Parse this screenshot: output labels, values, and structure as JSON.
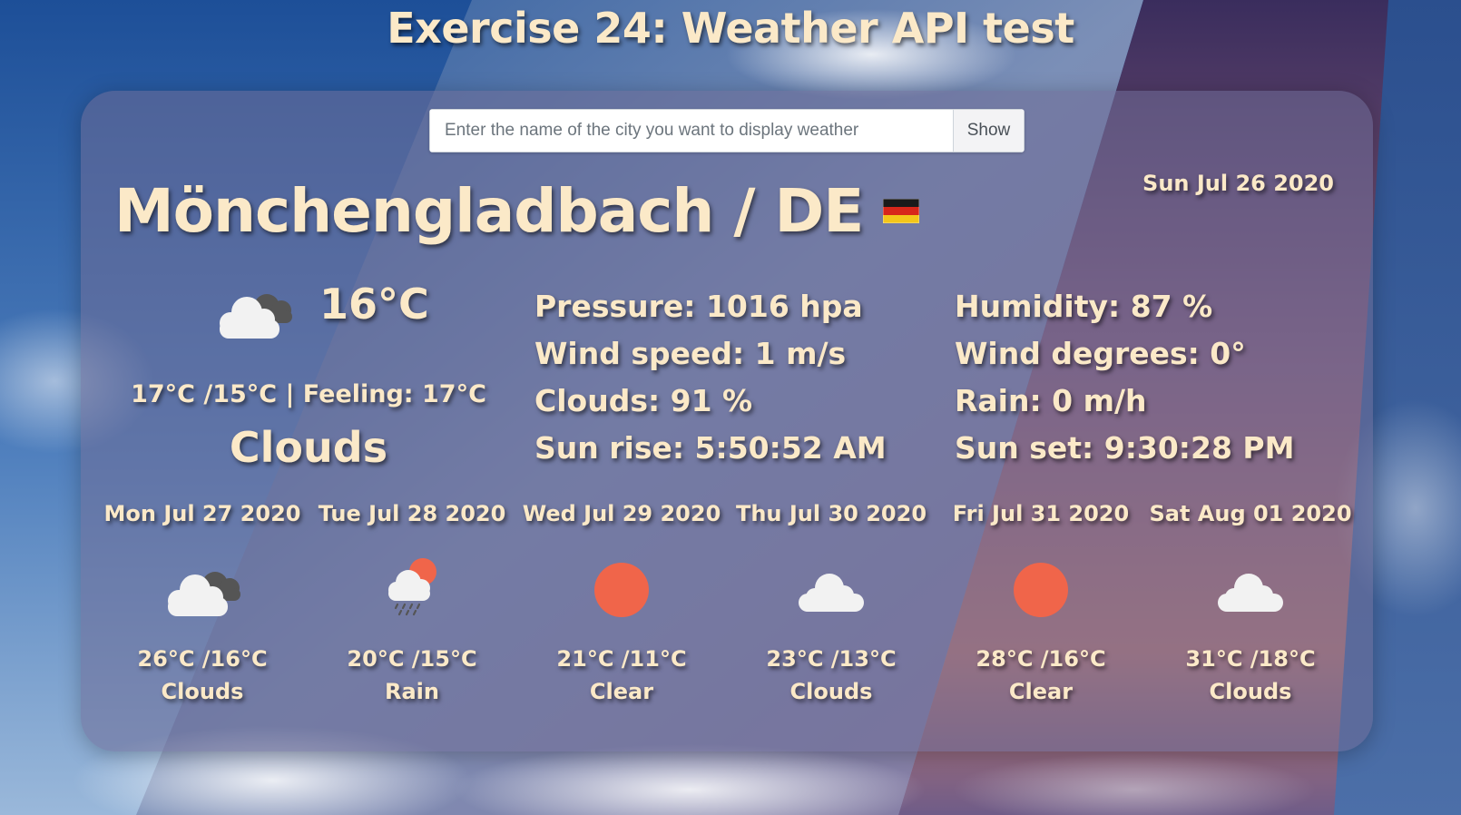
{
  "page": {
    "title": "Exercise 24: Weather API test"
  },
  "search": {
    "placeholder": "Enter the name of the city you want to display weather",
    "value": "",
    "button_label": "Show"
  },
  "current": {
    "city_label": "Mönchengladbach / DE",
    "flag_icon": "germany-flag-icon",
    "date": "Sun Jul 26 2020",
    "icon": "cloudy-icon",
    "temperature": "16°C",
    "min_max_feeling": "17°C /15°C | Feeling: 17°C",
    "condition": "Clouds",
    "details_left": [
      "Pressure: 1016 hpa",
      "Wind speed: 1 m/s",
      "Clouds: 91 %",
      "Sun rise: 5:50:52 AM"
    ],
    "details_right": [
      "Humidity: 87 %",
      "Wind degrees: 0°",
      "Rain: 0 m/h",
      "Sun set: 9:30:28 PM"
    ]
  },
  "forecast": [
    {
      "date": "Mon Jul 27 2020",
      "icon": "cloudy-icon",
      "temps": "26°C /16°C",
      "condition": "Clouds"
    },
    {
      "date": "Tue Jul 28 2020",
      "icon": "rain-sun-icon",
      "temps": "20°C /15°C",
      "condition": "Rain"
    },
    {
      "date": "Wed Jul 29 2020",
      "icon": "sun-icon",
      "temps": "21°C /11°C",
      "condition": "Clear"
    },
    {
      "date": "Thu Jul 30 2020",
      "icon": "cloud-icon",
      "temps": "23°C /13°C",
      "condition": "Clouds"
    },
    {
      "date": "Fri Jul 31 2020",
      "icon": "sun-icon",
      "temps": "28°C /16°C",
      "condition": "Clear"
    },
    {
      "date": "Sat Aug 01 2020",
      "icon": "cloud-icon",
      "temps": "31°C /18°C",
      "condition": "Clouds"
    }
  ],
  "colors": {
    "text": "#fbe9c8",
    "sun": "#f0654a",
    "cloud_white": "#f2f2f2",
    "cloud_dark": "#555555",
    "card": "#6e6c96"
  }
}
